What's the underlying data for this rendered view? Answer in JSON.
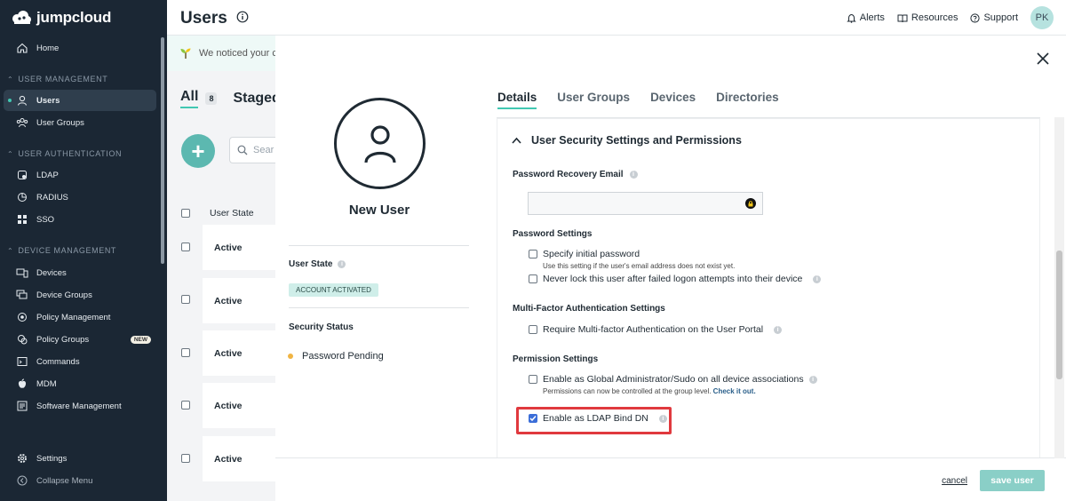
{
  "sidebar": {
    "logo_text": "jumpcloud",
    "home": "Home",
    "section_user_management": "USER MANAGEMENT",
    "users": "Users",
    "user_groups": "User Groups",
    "section_user_auth": "USER AUTHENTICATION",
    "ldap": "LDAP",
    "radius": "RADIUS",
    "sso": "SSO",
    "section_device_mgmt": "DEVICE MANAGEMENT",
    "devices": "Devices",
    "device_groups": "Device Groups",
    "policy_management": "Policy Management",
    "policy_groups": "Policy Groups",
    "new_badge": "NEW",
    "commands": "Commands",
    "mdm": "MDM",
    "software_management": "Software Management",
    "settings": "Settings",
    "collapse_menu": "Collapse Menu"
  },
  "header": {
    "title": "Users",
    "alerts": "Alerts",
    "resources": "Resources",
    "support": "Support",
    "avatar_initials": "PK"
  },
  "background": {
    "notice": "We noticed your c",
    "tab_all": "All",
    "tab_all_count": "8",
    "tab_staged": "Staged",
    "search_placeholder": "Sear",
    "column_user_state": "User State",
    "rows": [
      "Active",
      "Active",
      "Active",
      "Active",
      "Active"
    ]
  },
  "modal": {
    "new_user": "New User",
    "user_state_label": "User State",
    "account_status": "ACCOUNT ACTIVATED",
    "security_status_label": "Security Status",
    "password_pending": "Password Pending",
    "tabs": [
      "Details",
      "User Groups",
      "Devices",
      "Directories"
    ],
    "panel_title": "User Security Settings and Permissions",
    "password_recovery_email": "Password Recovery Email",
    "password_settings": "Password Settings",
    "specify_initial_password": "Specify initial password",
    "specify_initial_password_sub": "Use this setting if the user's email address does not exist yet.",
    "never_lock": "Never lock this user after failed logon attempts into their device",
    "mfa_settings": "Multi-Factor Authentication Settings",
    "require_mfa": "Require Multi-factor Authentication on the User Portal",
    "permission_settings": "Permission Settings",
    "global_admin": "Enable as Global Administrator/Sudo on all device associations",
    "global_admin_sub": "Permissions can now be controlled at the group level.",
    "check_it_out": "Check it out.",
    "ldap_bind": "Enable as LDAP Bind DN",
    "cancel": "cancel",
    "save_user": "save user"
  },
  "colors": {
    "sidebar_bg": "#1b2734",
    "accent": "#41c8b2",
    "save_button": "#8acfc7",
    "highlight": "#e0393e"
  }
}
